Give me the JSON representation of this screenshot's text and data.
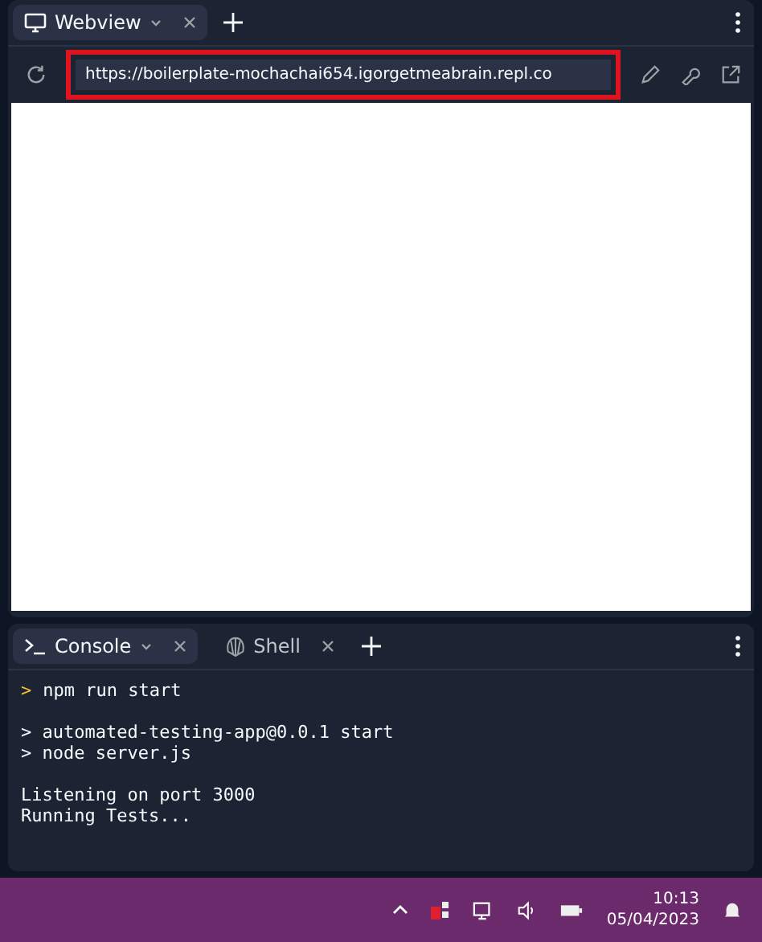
{
  "webview_pane": {
    "tabs": [
      {
        "label": "Webview",
        "selected": true,
        "kind": "monitor"
      }
    ],
    "url": "https://boilerplate-mochachai654.igorgetmeabrain.repl.co",
    "highlighted": true
  },
  "console_pane": {
    "tabs": [
      {
        "label": "Console",
        "selected": true,
        "kind": "terminal"
      },
      {
        "label": "Shell",
        "selected": false,
        "kind": "shell"
      }
    ],
    "lines": [
      {
        "kind": "prompt",
        "marker": ">",
        "text": "npm run start"
      },
      {
        "kind": "blank"
      },
      {
        "kind": "output",
        "text": "> automated-testing-app@0.0.1 start"
      },
      {
        "kind": "output",
        "text": "> node server.js"
      },
      {
        "kind": "blank"
      },
      {
        "kind": "output",
        "text": "Listening on port 3000"
      },
      {
        "kind": "output",
        "text": "Running Tests..."
      }
    ]
  },
  "taskbar": {
    "time": "10:13",
    "date": "05/04/2023"
  }
}
